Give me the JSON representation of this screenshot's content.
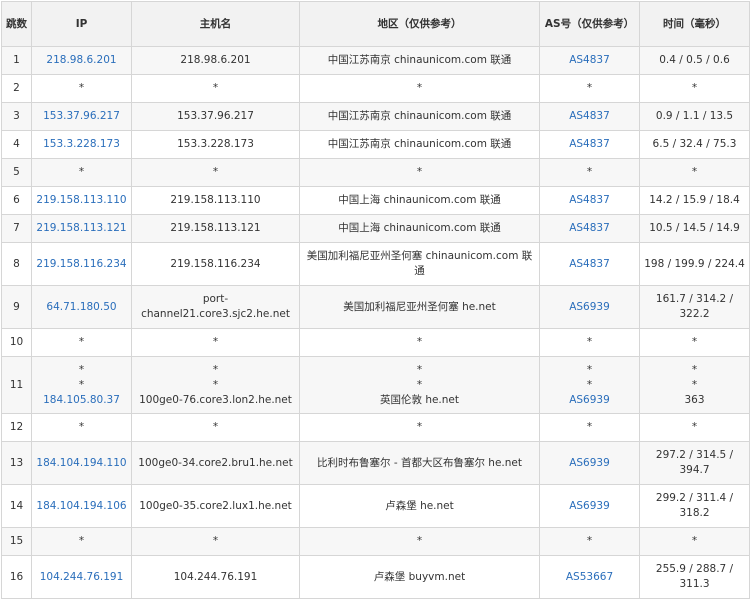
{
  "headers": [
    "跳数",
    "IP",
    "主机名",
    "地区（仅供参考）",
    "AS号（仅供参考）",
    "时间（毫秒）"
  ],
  "rows": [
    {
      "hop": "1",
      "ip": [
        "218.98.6.201"
      ],
      "host": [
        "218.98.6.201"
      ],
      "region": [
        "中国江苏南京 chinaunicom.com 联通"
      ],
      "as": [
        "AS4837"
      ],
      "time": [
        "0.4 / 0.5 / 0.6"
      ]
    },
    {
      "hop": "2",
      "ip": [
        "*"
      ],
      "host": [
        "*"
      ],
      "region": [
        "*"
      ],
      "as": [
        "*"
      ],
      "time": [
        "*"
      ]
    },
    {
      "hop": "3",
      "ip": [
        "153.37.96.217"
      ],
      "host": [
        "153.37.96.217"
      ],
      "region": [
        "中国江苏南京 chinaunicom.com 联通"
      ],
      "as": [
        "AS4837"
      ],
      "time": [
        "0.9 / 1.1 / 13.5"
      ]
    },
    {
      "hop": "4",
      "ip": [
        "153.3.228.173"
      ],
      "host": [
        "153.3.228.173"
      ],
      "region": [
        "中国江苏南京 chinaunicom.com 联通"
      ],
      "as": [
        "AS4837"
      ],
      "time": [
        "6.5 / 32.4 / 75.3"
      ]
    },
    {
      "hop": "5",
      "ip": [
        "*"
      ],
      "host": [
        "*"
      ],
      "region": [
        "*"
      ],
      "as": [
        "*"
      ],
      "time": [
        "*"
      ]
    },
    {
      "hop": "6",
      "ip": [
        "219.158.113.110"
      ],
      "host": [
        "219.158.113.110"
      ],
      "region": [
        "中国上海 chinaunicom.com 联通"
      ],
      "as": [
        "AS4837"
      ],
      "time": [
        "14.2 / 15.9 / 18.4"
      ]
    },
    {
      "hop": "7",
      "ip": [
        "219.158.113.121"
      ],
      "host": [
        "219.158.113.121"
      ],
      "region": [
        "中国上海 chinaunicom.com 联通"
      ],
      "as": [
        "AS4837"
      ],
      "time": [
        "10.5 / 14.5 / 14.9"
      ]
    },
    {
      "hop": "8",
      "ip": [
        "219.158.116.234"
      ],
      "host": [
        "219.158.116.234"
      ],
      "region": [
        "美国加利福尼亚州圣何塞 chinaunicom.com 联通"
      ],
      "as": [
        "AS4837"
      ],
      "time": [
        "198 / 199.9 / 224.4"
      ]
    },
    {
      "hop": "9",
      "ip": [
        "64.71.180.50"
      ],
      "host": [
        "port-channel21.core3.sjc2.he.net"
      ],
      "region": [
        "美国加利福尼亚州圣何塞 he.net"
      ],
      "as": [
        "AS6939"
      ],
      "time": [
        "161.7 / 314.2 / 322.2"
      ]
    },
    {
      "hop": "10",
      "ip": [
        "*"
      ],
      "host": [
        "*"
      ],
      "region": [
        "*"
      ],
      "as": [
        "*"
      ],
      "time": [
        "*"
      ]
    },
    {
      "hop": "11",
      "ip": [
        "*",
        "*",
        "184.105.80.37"
      ],
      "host": [
        "*",
        "*",
        "100ge0-76.core3.lon2.he.net"
      ],
      "region": [
        "*",
        "*",
        "英国伦敦 he.net"
      ],
      "as": [
        "*",
        "*",
        "AS6939"
      ],
      "time": [
        "*",
        "*",
        "363"
      ]
    },
    {
      "hop": "12",
      "ip": [
        "*"
      ],
      "host": [
        "*"
      ],
      "region": [
        "*"
      ],
      "as": [
        "*"
      ],
      "time": [
        "*"
      ]
    },
    {
      "hop": "13",
      "ip": [
        "184.104.194.110"
      ],
      "host": [
        "100ge0-34.core2.bru1.he.net"
      ],
      "region": [
        "比利时布鲁塞尔 - 首都大区布鲁塞尔 he.net"
      ],
      "as": [
        "AS6939"
      ],
      "time": [
        "297.2 / 314.5 / 394.7"
      ]
    },
    {
      "hop": "14",
      "ip": [
        "184.104.194.106"
      ],
      "host": [
        "100ge0-35.core2.lux1.he.net"
      ],
      "region": [
        "卢森堡 he.net"
      ],
      "as": [
        "AS6939"
      ],
      "time": [
        "299.2 / 311.4 / 318.2"
      ]
    },
    {
      "hop": "15",
      "ip": [
        "*"
      ],
      "host": [
        "*"
      ],
      "region": [
        "*"
      ],
      "as": [
        "*"
      ],
      "time": [
        "*"
      ]
    },
    {
      "hop": "16",
      "ip": [
        "104.244.76.191"
      ],
      "host": [
        "104.244.76.191"
      ],
      "region": [
        "卢森堡 buyvm.net"
      ],
      "as": [
        "AS53667"
      ],
      "time": [
        "255.9 / 288.7 / 311.3"
      ]
    }
  ]
}
